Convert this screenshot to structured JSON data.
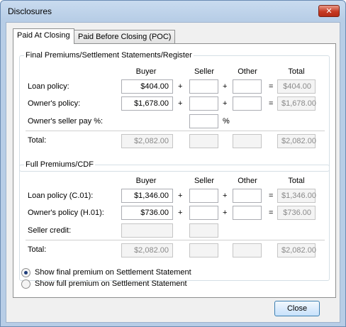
{
  "window": {
    "title": "Disclosures",
    "close_icon": "close-icon"
  },
  "tabs": [
    {
      "label": "Paid At Closing",
      "active": true
    },
    {
      "label": "Paid Before Closing (POC)",
      "active": false
    }
  ],
  "final": {
    "caption": "Final Premiums/Settlement Statements/Register",
    "columns": {
      "buyer": "Buyer",
      "seller": "Seller",
      "other": "Other",
      "total": "Total"
    },
    "rows": {
      "loan": {
        "label": "Loan policy:",
        "buyer": "$404.00",
        "seller": "",
        "other": "",
        "total": "$404.00"
      },
      "owner": {
        "label": "Owner's policy:",
        "buyer": "$1,678.00",
        "seller": "",
        "other": "",
        "total": "$1,678.00"
      },
      "seller_pay": {
        "label": "Owner's seller pay %:",
        "value": "",
        "unit": "%"
      },
      "total": {
        "label": "Total:",
        "buyer": "$2,082.00",
        "seller": "",
        "other": "",
        "total": "$2,082.00"
      }
    },
    "ops": {
      "plus": "+",
      "equals": "="
    }
  },
  "full": {
    "caption": "Full Premiums/CDF",
    "columns": {
      "buyer": "Buyer",
      "seller": "Seller",
      "other": "Other",
      "total": "Total"
    },
    "rows": {
      "loan": {
        "label": "Loan policy (C.01):",
        "buyer": "$1,346.00",
        "seller": "",
        "other": "",
        "total": "$1,346.00"
      },
      "owner": {
        "label": "Owner's policy (H.01):",
        "buyer": "$736.00",
        "seller": "",
        "other": "",
        "total": "$736.00"
      },
      "seller_credit": {
        "label": "Seller credit:",
        "buyer": "",
        "seller": ""
      },
      "total": {
        "label": "Total:",
        "buyer": "$2,082.00",
        "seller": "",
        "other": "",
        "total": "$2,082.00"
      }
    },
    "ops": {
      "plus": "+",
      "equals": "="
    }
  },
  "options": {
    "show_final": {
      "label": "Show final premium on Settlement Statement",
      "checked": true
    },
    "show_full": {
      "label": "Show full premium on Settlement Statement",
      "checked": false
    }
  },
  "buttons": {
    "close": "Close"
  }
}
